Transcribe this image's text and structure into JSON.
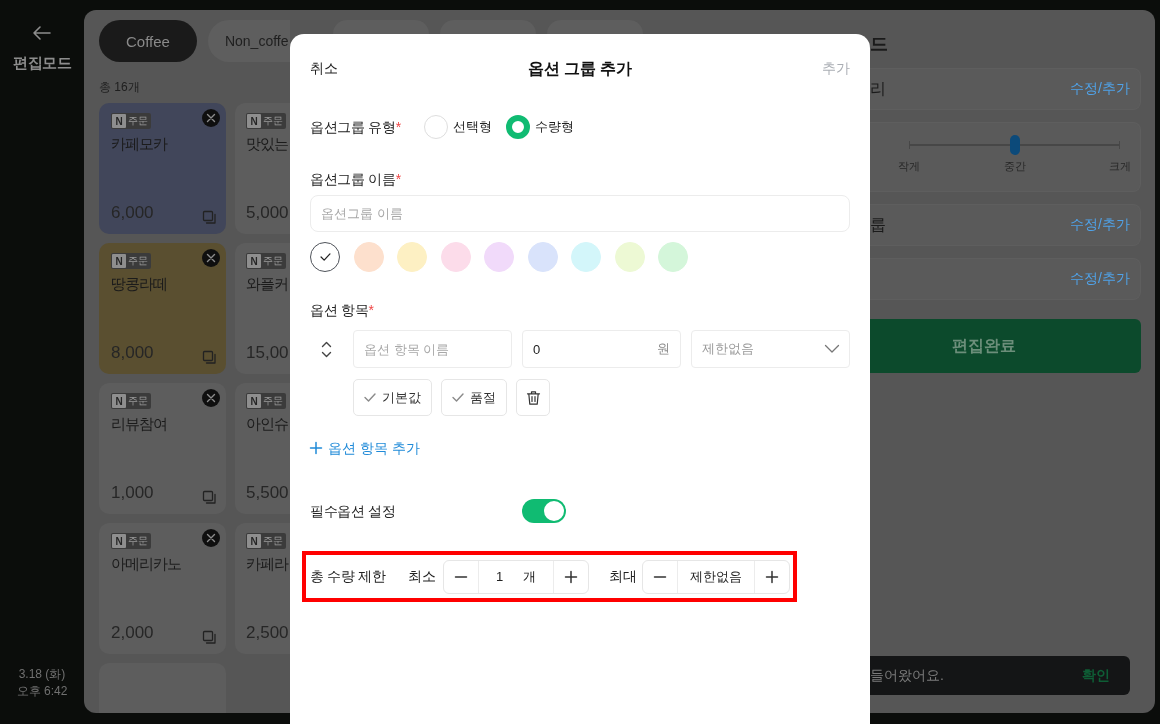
{
  "sidebar": {
    "title": "편집모드",
    "date": "3.18 (화)",
    "time": "오후 6:42"
  },
  "menu": {
    "tabs": [
      {
        "kind": "pill",
        "label": "Coffee",
        "selected": true
      },
      {
        "kind": "cut",
        "label": "Non_coffe",
        "selected": false
      },
      {
        "kind": "edge",
        "selected": false
      },
      {
        "kind": "edge",
        "selected": false
      },
      {
        "kind": "edge",
        "selected": false
      }
    ],
    "count": "총 16개",
    "products": [
      {
        "kind": "full",
        "badge": {
          "mark": "N",
          "label": "주문"
        },
        "name": "카페모카",
        "price": "6,000",
        "color": "#41465a"
      },
      {
        "kind": "cut",
        "badge": {
          "mark": "N",
          "label": "주문"
        },
        "name": "맛있는",
        "price": "5,000",
        "color": "#5d5d5d"
      },
      {
        "kind": "full",
        "badge": {
          "mark": "N",
          "label": "주문"
        },
        "name": "땅콩라떼",
        "price": "8,000",
        "color": "#5a4f30"
      },
      {
        "kind": "cut",
        "badge": {
          "mark": "N",
          "label": "주문"
        },
        "name": "와플커",
        "price": "15,00",
        "color": "#5d5d5d"
      },
      {
        "kind": "full",
        "badge": {
          "mark": "N",
          "label": "주문"
        },
        "name": "리뷰참여",
        "price": "1,000",
        "color": "#5d5d5d"
      },
      {
        "kind": "cut",
        "badge": {
          "mark": "N",
          "label": "주문"
        },
        "name": "아인슈",
        "price": "5,500",
        "color": "#5d5d5d"
      },
      {
        "kind": "full",
        "badge": {
          "mark": "N",
          "label": "주문"
        },
        "name": "아메리카노",
        "price": "2,000",
        "color": "#5d5d5d"
      },
      {
        "kind": "cut",
        "badge": {
          "mark": "N",
          "label": "주문"
        },
        "name": "카페라",
        "price": "2,500",
        "color": "#5d5d5d"
      },
      {
        "kind": "blank",
        "color": "#5d5d5d"
      }
    ]
  },
  "settings": {
    "title": "드",
    "rows": [
      {
        "kind": "link",
        "label": "리",
        "action": "수정/추가"
      },
      {
        "kind": "slider",
        "level": 0.5,
        "marks": [
          "작게",
          "중간",
          "크게"
        ]
      },
      {
        "kind": "link",
        "label": "룹",
        "action": "수정/추가"
      },
      {
        "kind": "link",
        "action": "수정/추가"
      }
    ],
    "done_button": "편집완료"
  },
  "toast": {
    "message": "들어왔어요.",
    "action": "확인"
  },
  "dialog": {
    "cancel": "취소",
    "title": "옵션 그룹 추가",
    "confirm": "추가",
    "group_type": {
      "label": "옵션그룹 유형",
      "mark": "*",
      "options": [
        {
          "label": "선택형",
          "selected": false
        },
        {
          "label": "수량형",
          "selected": true
        }
      ]
    },
    "group_name": {
      "label": "옵션그룹 이름",
      "mark": "*",
      "placeholder": "옵션그룹 이름"
    },
    "swatches": [
      {
        "color": "#ffffff",
        "selected": true
      },
      {
        "color": "#fde0cd",
        "selected": false
      },
      {
        "color": "#fdf0c3",
        "selected": false
      },
      {
        "color": "#fcdcea",
        "selected": false
      },
      {
        "color": "#f1dafa",
        "selected": false
      },
      {
        "color": "#d9e3fb",
        "selected": false
      },
      {
        "color": "#d3f6fa",
        "selected": false
      },
      {
        "color": "#edf9d4",
        "selected": false
      },
      {
        "color": "#d4f6da",
        "selected": false
      }
    ],
    "option_items": {
      "label": "옵션 항목",
      "mark": "*",
      "items": [
        {
          "name": {
            "placeholder": "옵션 항목 이름"
          },
          "price": {
            "value": "0",
            "unit": "원"
          },
          "limit": {
            "placeholder": "제한없음"
          },
          "toggles": [
            {
              "label": "기본값",
              "checked": false
            },
            {
              "label": "품절",
              "checked": false
            }
          ]
        }
      ],
      "add": "옵션 항목 추가"
    },
    "required_option": {
      "label": "필수옵션 설정",
      "on": true
    },
    "quantity_limit": {
      "label": "총 수량 제한",
      "highlighted": true,
      "min": {
        "label": "최소",
        "value": "1",
        "unit": "개"
      },
      "max": {
        "label": "최대",
        "value": "제한없음"
      }
    }
  }
}
